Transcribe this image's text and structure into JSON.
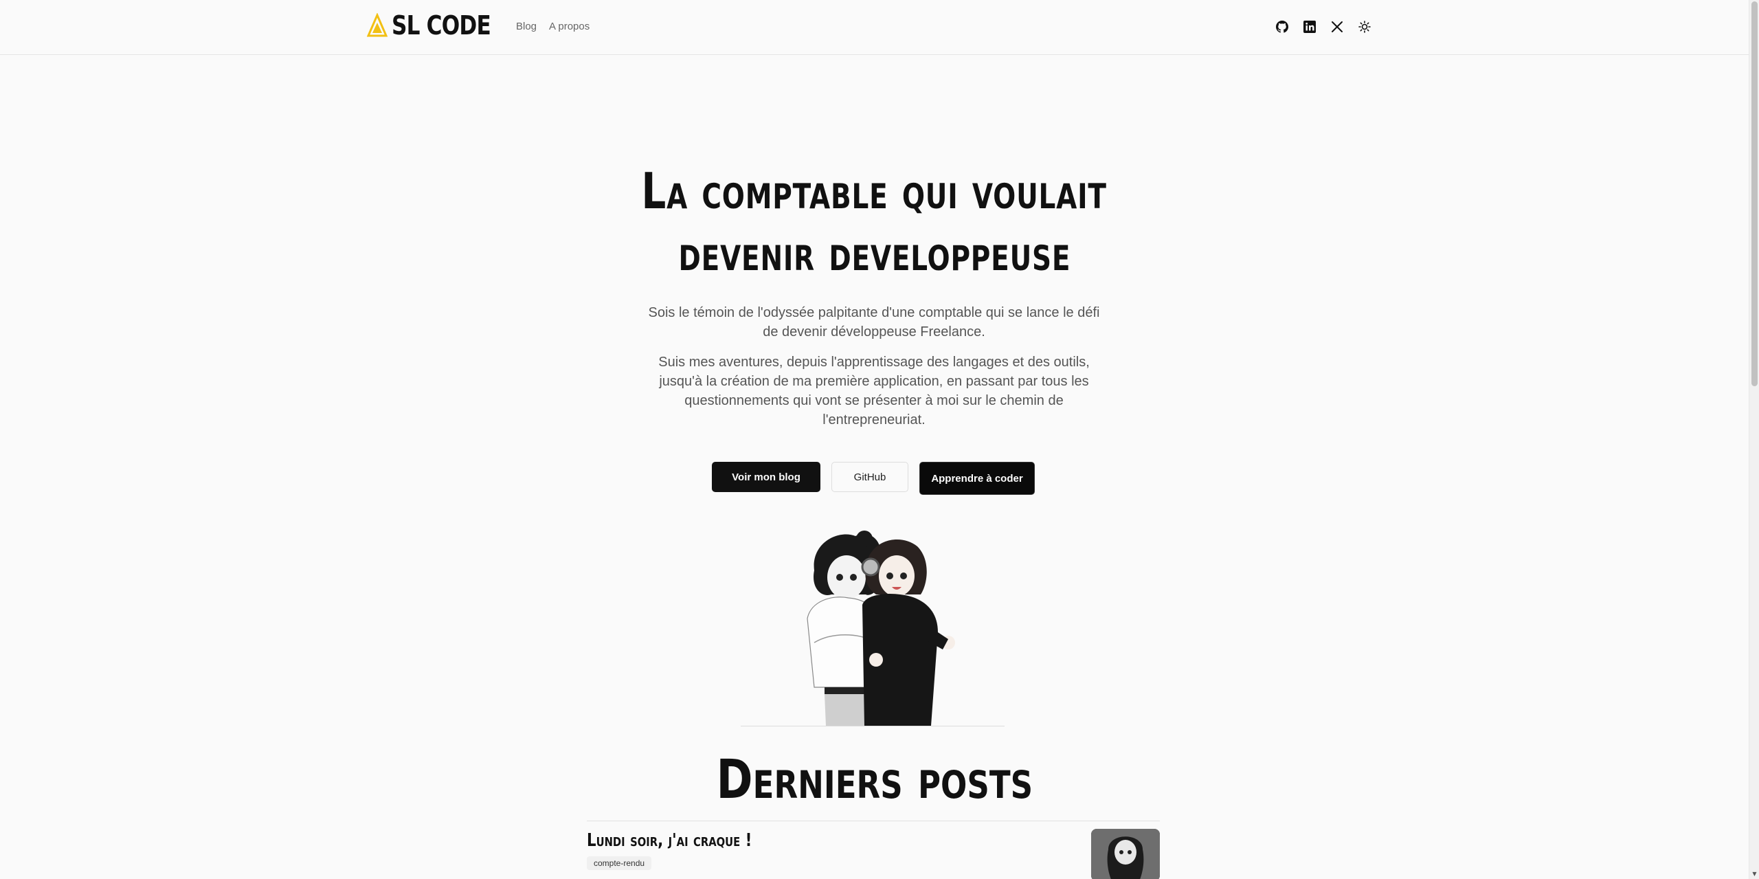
{
  "header": {
    "logo_text": "SL CODE",
    "nav": [
      "Blog",
      "A propos"
    ],
    "icons": [
      "github-icon",
      "linkedin-icon",
      "x-icon",
      "theme-toggle-icon"
    ]
  },
  "hero": {
    "title_line1": "La comptable qui voulait",
    "title_line2": "devenir developpeuse",
    "paragraph1": "Sois le témoin de l'odyssée palpitante d'une comptable qui se lance le défi de devenir développeuse Freelance.",
    "paragraph2": "Suis mes aventures, depuis l'apprentissage des langages et des outils, jusqu'à la création de ma première application, en passant par tous les questionnements qui vont se présenter à moi sur le chemin de l'entrepreneuriat.",
    "buttons": {
      "blog": "Voir mon blog",
      "github": "GitHub",
      "learn": "Apprendre à coder"
    }
  },
  "latest": {
    "title": "Derniers posts",
    "posts": [
      {
        "title": "Lundi soir, j'ai craque !",
        "tag": "compte-rendu"
      }
    ]
  },
  "colors": {
    "background": "#fafafa",
    "text": "#111111",
    "muted": "#555555",
    "accent": "#f2c014"
  }
}
